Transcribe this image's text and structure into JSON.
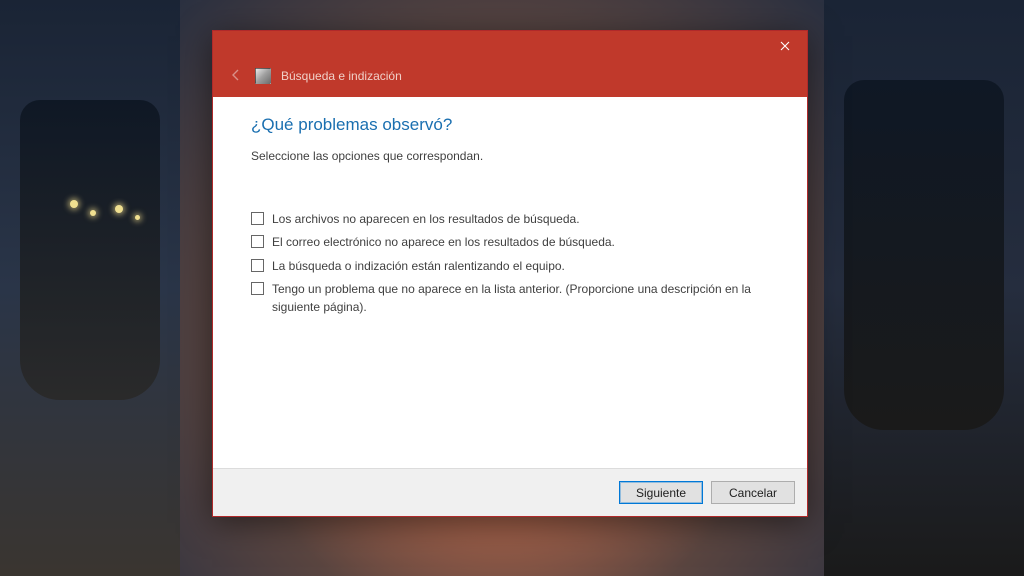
{
  "colors": {
    "accent_red": "#c0392b",
    "link_blue": "#1a6fb0",
    "button_focus": "#0078d7"
  },
  "header": {
    "breadcrumb": "Búsqueda e indización"
  },
  "main": {
    "heading": "¿Qué problemas observó?",
    "instruction": "Seleccione las opciones que correspondan.",
    "options": [
      {
        "label": "Los archivos no aparecen en los resultados de búsqueda.",
        "checked": false
      },
      {
        "label": "El correo electrónico no aparece en los resultados de búsqueda.",
        "checked": false
      },
      {
        "label": "La búsqueda o indización están ralentizando el equipo.",
        "checked": false
      },
      {
        "label": "Tengo un problema que no aparece en la lista anterior. (Proporcione una descripción en la siguiente página).",
        "checked": false
      }
    ]
  },
  "footer": {
    "next_label": "Siguiente",
    "cancel_label": "Cancelar"
  }
}
